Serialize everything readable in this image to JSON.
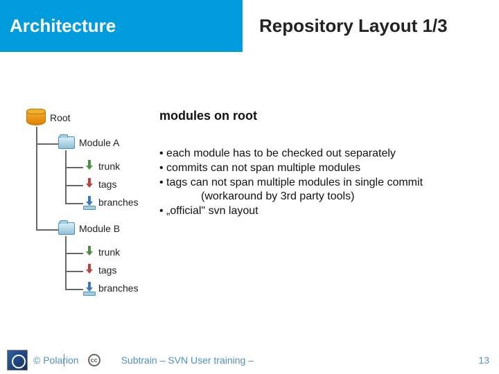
{
  "header": {
    "section": "Architecture",
    "title": "Repository Layout 1/3"
  },
  "subtitle": "modules on root",
  "bullets": {
    "b1": "• each module has to be checked out  separately",
    "b2": "• commits can not span multiple modules",
    "b3": "• tags can not  span multiple modules in single commit",
    "b3a": "(workaround by 3rd party tools)",
    "b4": "• „official\" svn layout"
  },
  "tree": {
    "root": "Root",
    "modA": "Module A",
    "modB": "Module B",
    "trunk": "trunk",
    "tags": "tags",
    "branches": "branches"
  },
  "footer": {
    "copyright": "© Polarion",
    "center": "Subtrain – SVN User training –",
    "page": "13",
    "cc": "cc"
  }
}
